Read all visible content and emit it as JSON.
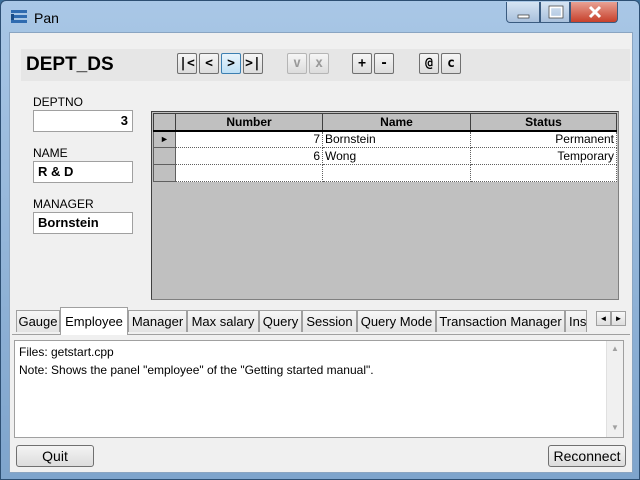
{
  "window": {
    "title": "Pan"
  },
  "form": {
    "title": "DEPT_DS",
    "nav_buttons": [
      "|<",
      "<",
      ">",
      ">|"
    ],
    "edit_buttons": [
      "v",
      "x"
    ],
    "row_buttons": [
      "+",
      "-"
    ],
    "misc_buttons": [
      "@",
      "c"
    ],
    "fields": [
      {
        "label": "DEPTNO",
        "value": "3"
      },
      {
        "label": "NAME",
        "value": "R & D"
      },
      {
        "label": "MANAGER",
        "value": "Bornstein"
      }
    ]
  },
  "grid": {
    "columns": [
      "Number",
      "Name",
      "Status"
    ],
    "rows": [
      {
        "indicator": "►",
        "number": "7",
        "name": "Bornstein",
        "status": "Permanent"
      },
      {
        "indicator": "",
        "number": "6",
        "name": "Wong",
        "status": "Temporary"
      },
      {
        "indicator": "",
        "number": "",
        "name": "",
        "status": ""
      }
    ]
  },
  "tabs": [
    "Gauge",
    "Employee",
    "Manager",
    "Max salary",
    "Query",
    "Session",
    "Query Mode",
    "Transaction Manager",
    "Ins"
  ],
  "active_tab": "Employee",
  "notes": {
    "line1": "Files: getstart.cpp",
    "line2": "Note: Shows the panel \"employee\" of the \"Getting started manual\"."
  },
  "buttons": {
    "quit": "Quit",
    "reconnect": "Reconnect"
  },
  "colors": {
    "titlebar": "#a9c7e6",
    "close": "#c7402b",
    "grid_bg": "#c0c0c0"
  }
}
